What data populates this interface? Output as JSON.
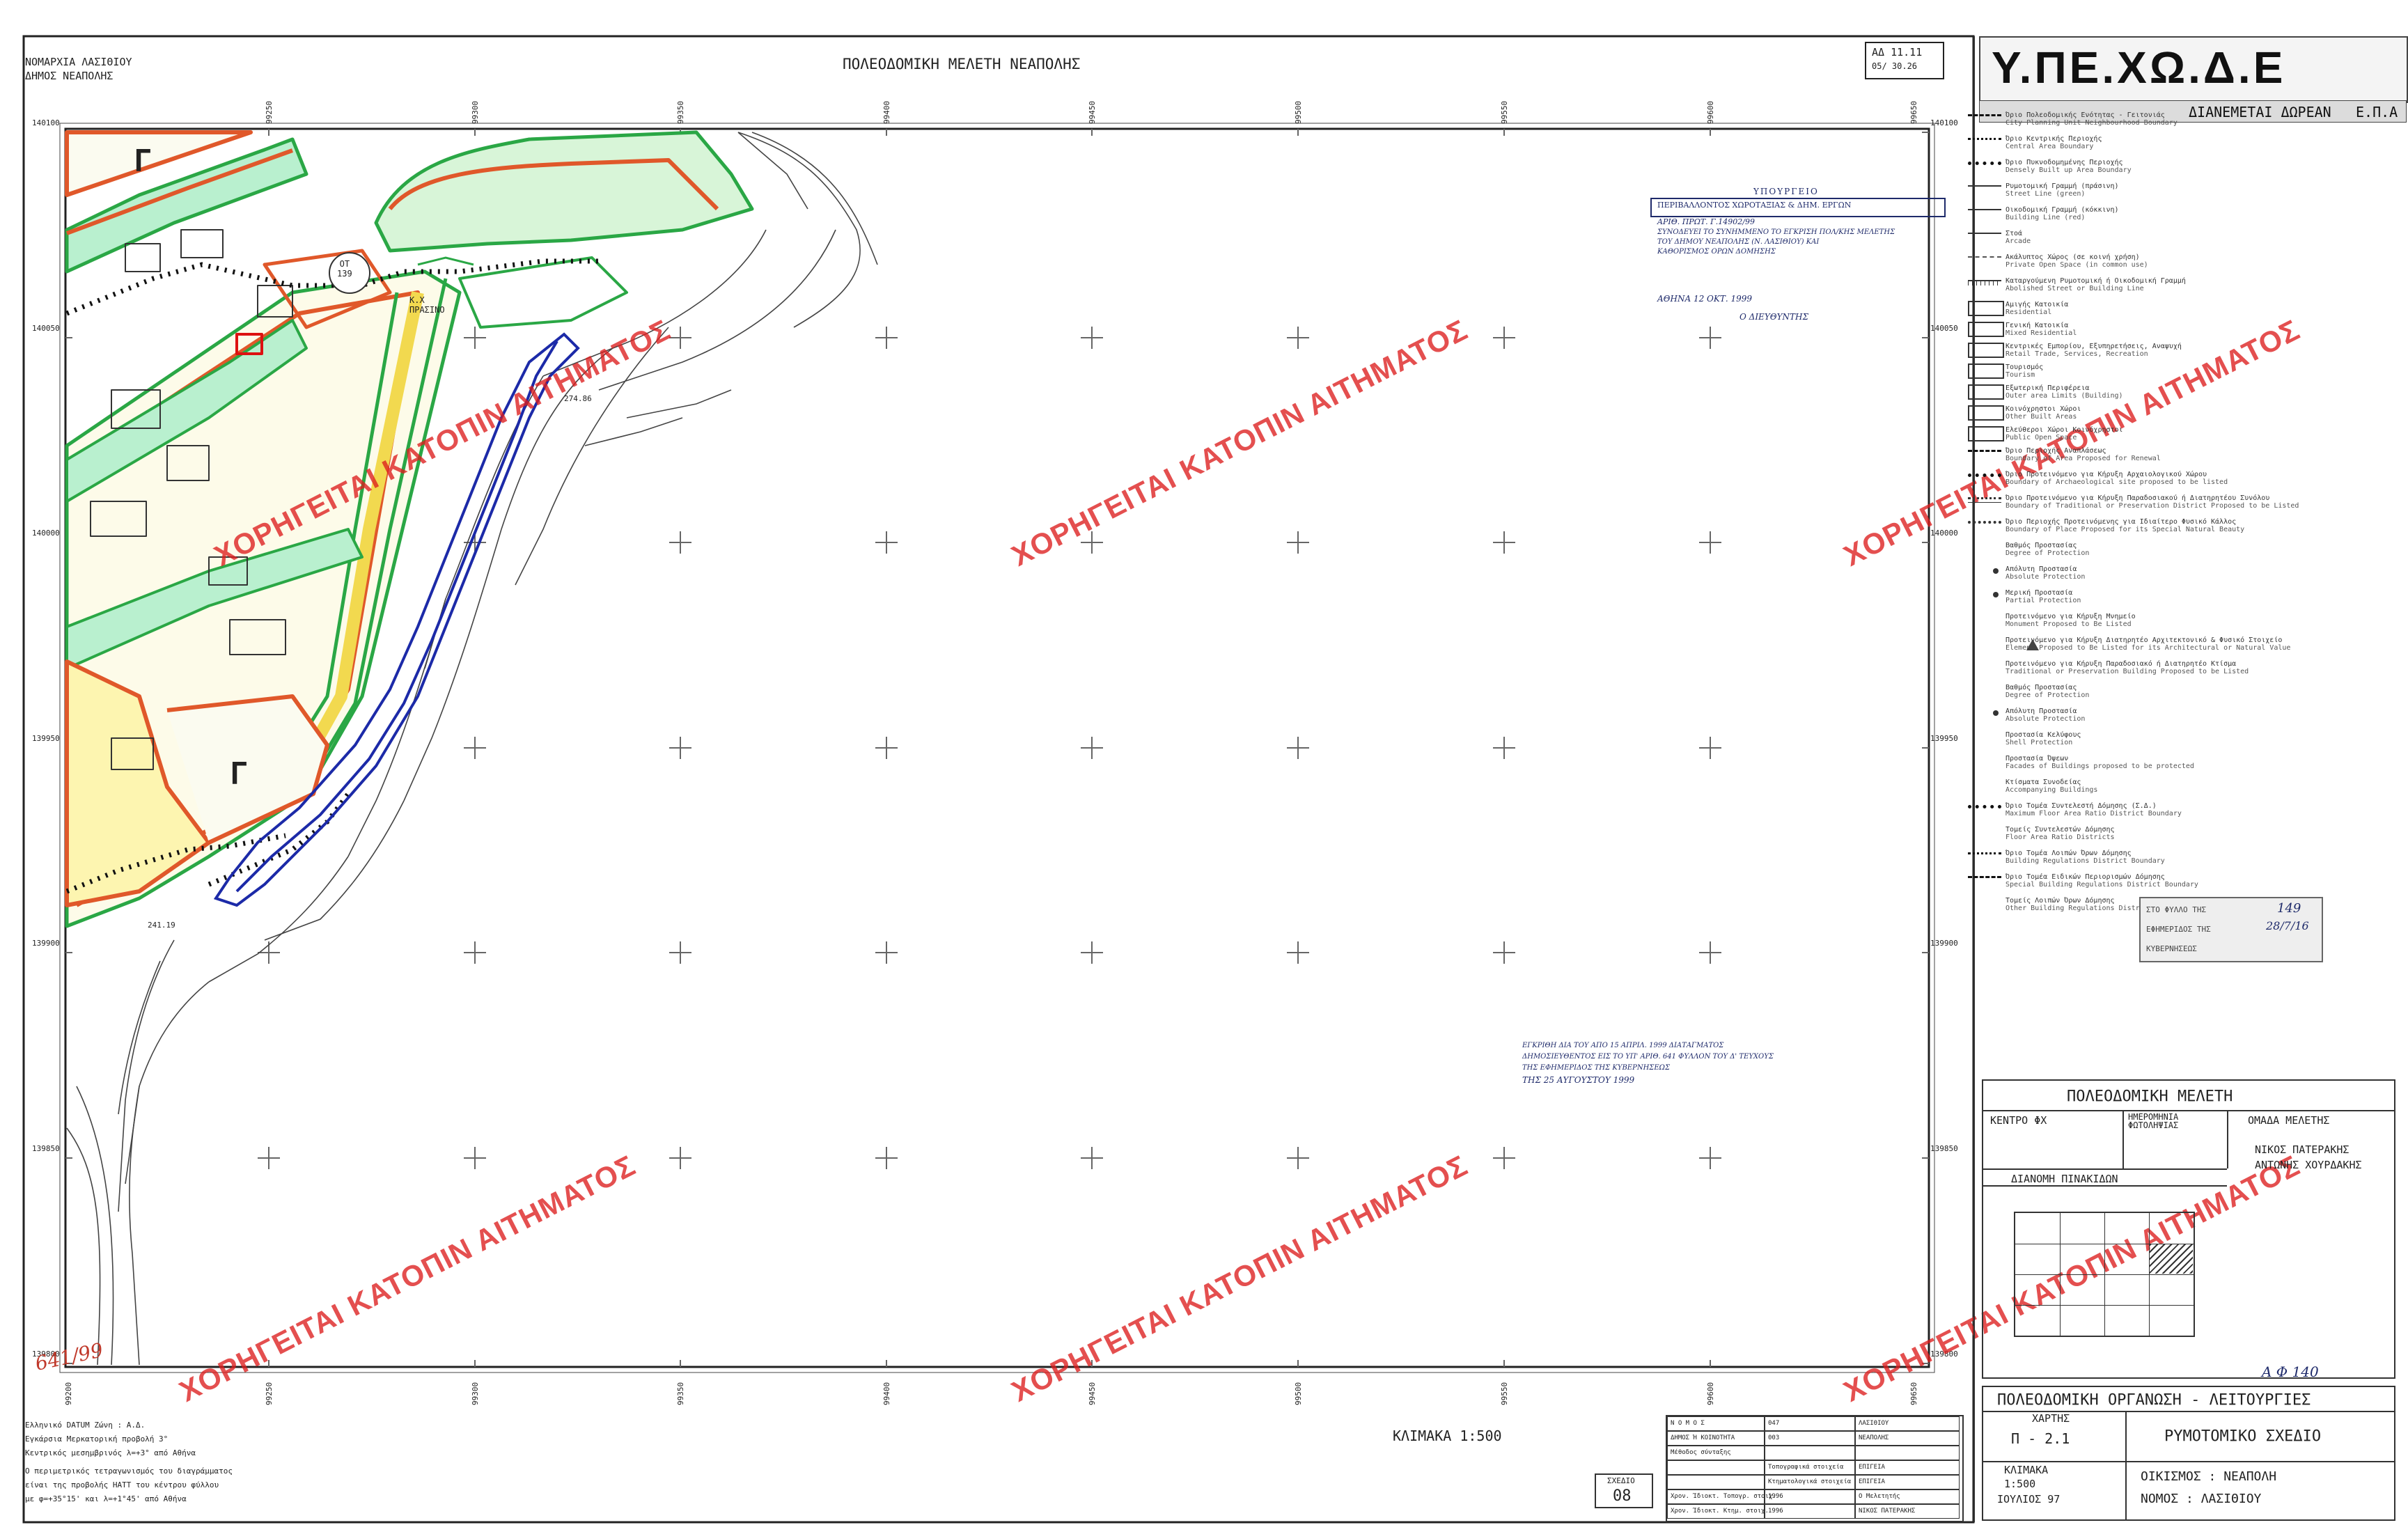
{
  "sheet": {
    "header_left": [
      "ΝΟΜΑΡΧΙΑ ΛΑΣΙΘΙΟΥ",
      "ΔΗΜΟΣ     ΝΕΑΠΟΛΗΣ"
    ],
    "title": "ΠΟΛΕΟΔΟΜΙΚΗ ΜΕΛΕΤΗ ΝΕΑΠΟΛΗΣ",
    "header_ref_top": "ΑΔ  11.11",
    "header_ref_bottom": "05/   30.26"
  },
  "grid": {
    "x_labels": [
      "99250",
      "99300",
      "99350",
      "99400",
      "99450",
      "99500",
      "99550",
      "99600",
      "99650"
    ],
    "y_labels": [
      "140100",
      "140050",
      "140000",
      "139950",
      "139900",
      "139850",
      "139800"
    ],
    "corner_bottom_left": "99200"
  },
  "map_labels": {
    "zone_gamma_1": "Γ",
    "zone_gamma_2": "Γ",
    "ot_label": "ΟΤ\n139",
    "kx_label": "Κ.Χ\nΠΡΑΣΙΝΟ",
    "elevation_1": "274.86",
    "elevation_2": "241.19",
    "corner_handwriting": "641/99"
  },
  "watermark_text": "ΧΟΡΗΓΕΙΤΑΙ ΚΑΤΟΠΙΝ ΑΙΤΗΜΑΤΟΣ",
  "stamp_top": {
    "line1": "ΥΠΟΥΡΓΕΙΟ",
    "line2": "ΠΕΡΙΒΑΛΛΟΝΤΟΣ ΧΩΡΟΤΑΞΙΑΣ & ΔΗΜ. ΕΡΓΩΝ",
    "line3": "ΑΡΙΘ. ΠΡΩΤ.  Γ.14902/99",
    "line4": "ΣΥΝΟΔΕΥΕΙ ΤΟ ΣΥΝΗΜΜΕΝΟ ΤΟ ΕΓΚΡΙΣΗ ΠΟΛ/ΚΗΣ ΜΕΛΕΤΗΣ",
    "line5": "ΤΟΥ ΔΗΜΟΥ ΝΕΑΠΟΛΗΣ (Ν. ΛΑΣΙΘΙΟΥ) ΚΑΙ",
    "line6": "ΚΑΘΟΡΙΣΜΟΣ ΟΡΩΝ ΔΟΜΗΣΗΣ",
    "date": "ΑΘΗΝΑ  12 ΟΚΤ. 1999",
    "sign": "Ο ΔΙΕΥΘΥΝΤΗΣ"
  },
  "stamp_mid": {
    "line1": "ΕΓΚΡΙΘΗ ΔΙΑ ΤΟΥ ΑΠΟ  15 ΑΠΡΙΛ.  1999 ΔΙΑΤΑΓΜΑΤΟΣ",
    "line2": "ΔΗΜΟΣΙΕΥΘΕΝΤΟΣ ΕΙΣ ΤΟ ΥΠ' ΑΡΙΘ.  641  ΦΥΛΛΟΝ ΤΟΥ Δ' ΤΕΥΧΟΥΣ",
    "line3": "ΤΗΣ ΕΦΗΜΕΡΙΔΟΣ ΤΗΣ ΚΥΒΕΡΝΗΣΕΩΣ",
    "line4": "ΤΗΣ  25 ΑΥΓΟΥΣΤΟΥ  1999"
  },
  "legend": [
    {
      "gr": "Όριο Πολεοδομικής Ενότητας - Γειτονιάς",
      "en": "City Planning Unit Neighbourhood Boundary",
      "sym": "dashdot-black"
    },
    {
      "gr": "Όριο Κεντρικής Περιοχής",
      "en": "Central Area Boundary",
      "sym": "dotted-black"
    },
    {
      "gr": "Όριο Πυκνοδομημένης Περιοχής",
      "en": "Densely Built up Area Boundary",
      "sym": "dotted-bold"
    },
    {
      "gr": "Ρυμοτομική Γραμμή (πράσινη)",
      "en": "Street Line (green)",
      "sym": "line-green"
    },
    {
      "gr": "Οικοδομική Γραμμή (κόκκινη)",
      "en": "Building Line (red)",
      "sym": "line-red"
    },
    {
      "gr": "Στοά",
      "en": "Arcade",
      "sym": "line-thin"
    },
    {
      "gr": "Ακάλυπτος Χώρος (σε κοινή χρήση)",
      "en": "Private Open Space (in common use)",
      "sym": "dashed"
    },
    {
      "gr": "Καταργούμενη Ρυμοτομική ή Οικοδομική Γραμμή",
      "en": "Abolished Street or Building Line",
      "sym": "crossed"
    },
    {
      "gr": "Αμιγής Κατοικία",
      "en": "Residential",
      "sym": "box"
    },
    {
      "gr": "Γενική Κατοικία",
      "en": "Mixed Residential",
      "sym": "box"
    },
    {
      "gr": "Κεντρικές Εμπορίου, Εξυπηρετήσεις, Αναψυχή",
      "en": "Retail Trade, Services, Recreation",
      "sym": "box"
    },
    {
      "gr": "Τουρισμός",
      "en": "Tourism",
      "sym": "box"
    },
    {
      "gr": "Εξωτερική Περιφέρεια",
      "en": "Outer area Limits (Building)",
      "sym": "box"
    },
    {
      "gr": "Κοινόχρηστοι Χώροι",
      "en": "Other Built Areas",
      "sym": "box"
    },
    {
      "gr": "Ελεύθεροι Χώροι Κοινόχρηστοι",
      "en": "Public Open Space",
      "sym": "box"
    },
    {
      "gr": "Όριο Περιοχής Αναπλάσεως",
      "en": "Boundary of Area Proposed for Renewal",
      "sym": "dashdot-black"
    },
    {
      "gr": "Όριο Προτεινόμενο για Κήρυξη Αρχαιολογικού Χώρου",
      "en": "Boundary of Archaeological site proposed to be listed",
      "sym": "dotted-bold"
    },
    {
      "gr": "Όριο Προτεινόμενο για Κήρυξη Παραδοσιακού ή Διατηρητέου Συνόλου",
      "en": "Boundary of Traditional or Preservation District Proposed to be Listed",
      "sym": "wavy"
    },
    {
      "gr": "Όριο Περιοχής Προτεινόμενης για Ιδιαίτερο Φυσικό Κάλλος",
      "en": "Boundary of Place Proposed for its Special Natural Beauty",
      "sym": "cross"
    },
    {
      "gr": "Βαθμός Προστασίας",
      "en": "Degree of Protection",
      "sym": "none"
    },
    {
      "gr": "Απόλυτη Προστασία",
      "en": "Absolute Protection",
      "sym": "bullet"
    },
    {
      "gr": "Μερική Προστασία",
      "en": "Partial Protection",
      "sym": "bullet"
    },
    {
      "gr": "Προτεινόμενο για Κήρυξη Μνημείο",
      "en": "Monument Proposed to Be Listed",
      "sym": "none"
    },
    {
      "gr": "Προτεινόμενο για Κήρυξη Διατηρητέο Αρχιτεκτονικό & Φυσικό Στοιχείο",
      "en": "Element Proposed to Be Listed for its Architectural or Natural Value",
      "sym": "triangle"
    },
    {
      "gr": "Προτεινόμενο για Κήρυξη Παραδοσιακό ή Διατηρητέο Κτίσμα",
      "en": "Traditional or Preservation Building Proposed to be Listed",
      "sym": "none"
    },
    {
      "gr": "Βαθμός Προστασίας",
      "en": "Degree of Protection",
      "sym": "none"
    },
    {
      "gr": "Απόλυτη Προστασία",
      "en": "Absolute Protection",
      "sym": "bullet"
    },
    {
      "gr": "Προστασία Κελύφους",
      "en": "Shell Protection",
      "sym": "none"
    },
    {
      "gr": "Προστασία Όψεων",
      "en": "Facades of Buildings proposed to be protected",
      "sym": "none"
    },
    {
      "gr": "Κτίσματα Συνοδείας",
      "en": "Accompanying Buildings",
      "sym": "none"
    },
    {
      "gr": "Όριο Τομέα Συντελεστή Δόμησης (Σ.Δ.)",
      "en": "Maximum Floor Area Ratio District Boundary",
      "sym": "dotted-bold"
    },
    {
      "gr": "Τομείς Συντελεστών Δόμησης",
      "en": "Floor Area Ratio Districts",
      "sym": "none"
    },
    {
      "gr": "Όριο Τομέα Λοιπών Όρων Δόμησης",
      "en": "Building Regulations District Boundary",
      "sym": "dotted-black"
    },
    {
      "gr": "Όριο Τομέα Ειδικών Περιορισμών Δόμησης",
      "en": "Special Building Regulations District Boundary",
      "sym": "dashdot-black"
    },
    {
      "gr": "Τομείς Λοιπών Όρων Δόμησης",
      "en": "Other Building Regulations Districts",
      "sym": "none"
    }
  ],
  "logo": {
    "text": "Υ.ΠΕ.ΧΩ.Δ.Ε",
    "subtitle": "ΔΙΑΝΕΜΕΤΑΙ ΔΩΡΕΑΝ",
    "subtitle_right": "Ε.Π.Α"
  },
  "side_stamp": {
    "line1": "ΣΤΟ ΦΥΛΛΟ ΤΗΣ",
    "line2": "ΕΦΗΜΕΡΙΔΟΣ ΤΗΣ",
    "line3": "ΚΥΒΕΡΝΗΣΕΩΣ",
    "handnote1": "149",
    "handnote2": "28/7/16"
  },
  "title_block": {
    "study_title": "ΠΟΛΕΟΔΟΜΙΚΗ    ΜΕΛΕΤΗ",
    "center_label": "ΚΕΝΤΡΟ  ΦΧ",
    "photo_date_label": "ΗΜΕΡΟΜΗΝΙΑ\nΦΩΤΟΛΗΨΙΑΣ",
    "team_label": "ΟΜΑΔΑ   ΜΕΛΕΤΗΣ",
    "team_members": [
      "ΝΙΚΟΣ  ΠΑΤΕΡΑΚΗΣ",
      "ΑΝΤΩΝΗΣ  ΧΟΥΡΔΑΚΗΣ"
    ],
    "distribution_label": "ΔΙΑΝΟΜΗ  ΠΙΝΑΚΙΔΩΝ",
    "handnote": "Α Φ 140",
    "org_title": "ΠΟΛΕΟΔΟΜΙΚΗ  ΟΡΓΑΝΩΣΗ  -  ΛΕΙΤΟΥΡΓΙΕΣ",
    "map_label": "ΧΑΡΤΗΣ",
    "map_code": "Π - 2.1",
    "map_name": "ΡΥΜΟΤΟΜΙΚΟ     ΣΧΕΔΙΟ",
    "scale_label": "ΚΛΙΜΑΚΑ",
    "scale_value": "1:500",
    "date_value": "ΙΟΥΛΙΟΣ   97",
    "settlement": "ΟΙΚΙΣΜΟΣ : ΝΕΑΠΟΛΗ",
    "prefecture": "ΝΟΜΟΣ : ΛΑΣΙΘΙΟΥ"
  },
  "bottom": {
    "scale_text": "ΚΛΙΜΑΚΑ  1:500",
    "datum_lines": [
      "Ελληνικό DATUM    Ζώνη : Α.Δ.",
      "Εγκάρσια Μερκατορική προβολή 3°",
      "Κεντρικός μεσημβρινός λ=+3° από Αθήνα",
      "Ο περιμετρικός τετραγωνισμός του διαγράμματος",
      "είναι της προβολής HATT του κέντρου φύλλου",
      "με φ=+35°15'  και  λ=+1°45'  από Αθήνα"
    ],
    "sheet_label": "ΣΧΕΔΙΟ",
    "sheet_number": "08",
    "info_table": [
      [
        "Ν Ο Μ Ο Σ",
        "047",
        "ΛΑΣΙΘΙΟΥ"
      ],
      [
        "ΔΗΜΟΣ Ή ΚΟΙΝΟΤΗΤΑ",
        "003",
        "ΝΕΑΠΟΛΗΣ"
      ],
      [
        "Μέθοδος σύνταξης",
        "",
        ""
      ],
      [
        "",
        "Τοπογραφικά στοιχεία",
        "ΕΠΙΓΕΙΑ"
      ],
      [
        "",
        "Κτηματολογικά στοιχεία",
        "ΕΠΙΓΕΙΑ"
      ],
      [
        "Χρον. Ίδιοκτ. Τοπογρ. στοιχ.",
        "1996",
        "Ο Μελετητής"
      ],
      [
        "Χρον. Ίδιοκτ. Κτημ. στοιχ.",
        "1996",
        "ΝΙΚΟΣ ΠΑΤΕΡΑΚΗΣ"
      ]
    ]
  }
}
